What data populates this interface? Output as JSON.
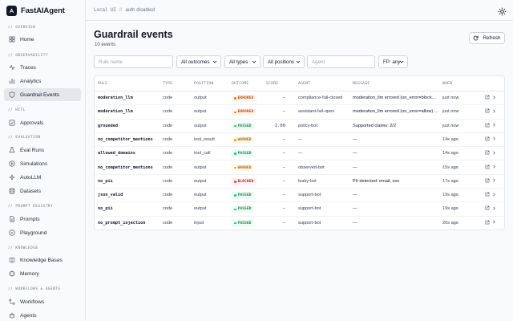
{
  "app": {
    "name": "FastAIAgent"
  },
  "breadcrumb": {
    "local": "Local UI",
    "sep": "//",
    "auth": "auth disabled"
  },
  "sidebar": {
    "groups": [
      {
        "label": "// OVERVIEW",
        "items": [
          {
            "label": "Home",
            "icon": "grid-icon"
          }
        ]
      },
      {
        "label": "// OBSERVABILITY",
        "items": [
          {
            "label": "Traces",
            "icon": "activity-icon"
          },
          {
            "label": "Analytics",
            "icon": "bar-chart-icon"
          },
          {
            "label": "Guardrail Events",
            "icon": "shield-icon",
            "active": true
          }
        ]
      },
      {
        "label": "// HITL",
        "items": [
          {
            "label": "Approvals",
            "icon": "check-square-icon"
          }
        ]
      },
      {
        "label": "// EVALUATION",
        "items": [
          {
            "label": "Eval Runs",
            "icon": "flask-icon"
          },
          {
            "label": "Simulations",
            "icon": "play-circle-icon"
          },
          {
            "label": "AutoLLM",
            "icon": "sparkle-icon"
          },
          {
            "label": "Datasets",
            "icon": "database-icon"
          }
        ]
      },
      {
        "label": "// PROMPT REGISTRY",
        "items": [
          {
            "label": "Prompts",
            "icon": "file-text-icon"
          },
          {
            "label": "Playground",
            "icon": "play-icon"
          }
        ]
      },
      {
        "label": "// KNOWLEDGE",
        "items": [
          {
            "label": "Knowledge Bases",
            "icon": "book-icon"
          },
          {
            "label": "Memory",
            "icon": "cpu-icon"
          }
        ]
      },
      {
        "label": "// WORKFLOWS & AGENTS",
        "items": [
          {
            "label": "Workflows",
            "icon": "workflow-icon"
          },
          {
            "label": "Agents",
            "icon": "bot-icon"
          }
        ]
      }
    ]
  },
  "header": {
    "title": "Guardrail events",
    "count": "10 events",
    "refresh": "Refresh"
  },
  "filters": {
    "rule_placeholder": "Rule name",
    "outcome": "All outcomes",
    "type": "All types",
    "position": "All positions",
    "agent_placeholder": "Agent",
    "fp": "FP: any"
  },
  "table": {
    "columns": [
      "RULE",
      "TYPE",
      "POSITION",
      "OUTCOME",
      "SCORE",
      "AGENT",
      "MESSAGE",
      "WHEN"
    ],
    "rows": [
      {
        "rule": "moderation_llm",
        "type": "code",
        "position": "output",
        "outcome": "ERRORED",
        "score": "—",
        "agent": "compliance-fail-closed",
        "message": "moderation_llm errored (on_error=block…",
        "when": "just now"
      },
      {
        "rule": "moderation_llm",
        "type": "code",
        "position": "output",
        "outcome": "ERRORED",
        "score": "—",
        "agent": "assistant-fail-open",
        "message": "moderation_llm errored (on_error=allow)…",
        "when": "just now"
      },
      {
        "rule": "grounded",
        "type": "code",
        "position": "output",
        "outcome": "PASSED",
        "score": "1.00",
        "agent": "policy-bot",
        "message": "Supported claims: 2/2",
        "when": "just now"
      },
      {
        "rule": "no_competitor_mentions",
        "type": "code",
        "position": "tool_result",
        "outcome": "WARNED",
        "score": "—",
        "agent": "—",
        "message": "—",
        "when": "14s ago"
      },
      {
        "rule": "allowed_domains",
        "type": "code",
        "position": "tool_call",
        "outcome": "PASSED",
        "score": "—",
        "agent": "—",
        "message": "—",
        "when": "14s ago"
      },
      {
        "rule": "no_competitor_mentions",
        "type": "code",
        "position": "output",
        "outcome": "WARNED",
        "score": "—",
        "agent": "observed-bot",
        "message": "—",
        "when": "15s ago"
      },
      {
        "rule": "no_pii",
        "type": "code",
        "position": "output",
        "outcome": "BLOCKED",
        "score": "—",
        "agent": "leaky-bot",
        "message": "PII detected: email, ssn",
        "when": "17s ago"
      },
      {
        "rule": "json_valid",
        "type": "code",
        "position": "output",
        "outcome": "PASSED",
        "score": "—",
        "agent": "support-bot",
        "message": "—",
        "when": "19s ago"
      },
      {
        "rule": "no_pii",
        "type": "code",
        "position": "output",
        "outcome": "PASSED",
        "score": "—",
        "agent": "support-bot",
        "message": "—",
        "when": "19s ago"
      },
      {
        "rule": "no_prompt_injection",
        "type": "code",
        "position": "input",
        "outcome": "PASSED",
        "score": "—",
        "agent": "support-bot",
        "message": "—",
        "when": "20s ago"
      }
    ]
  },
  "outcome_colors": {
    "ERRORED": {
      "bg": "#fff7ed",
      "fg": "#c2410c",
      "dot": "#f97316"
    },
    "PASSED": {
      "bg": "#ecfdf5",
      "fg": "#15803d",
      "dot": "#22c55e"
    },
    "WARNED": {
      "bg": "#fffbeb",
      "fg": "#b45309",
      "dot": "#f59e0b"
    },
    "BLOCKED": {
      "bg": "#fef2f2",
      "fg": "#b91c1c",
      "dot": "#ef4444"
    }
  }
}
